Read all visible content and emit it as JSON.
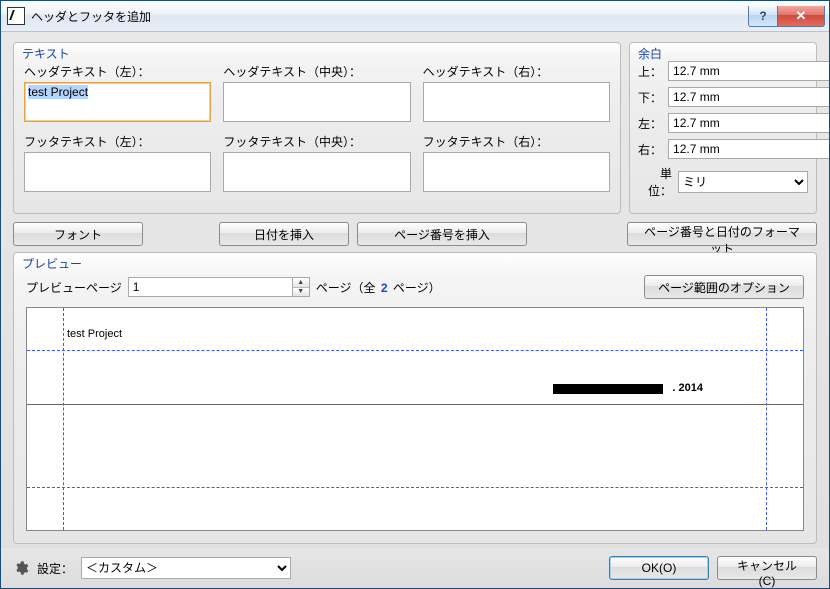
{
  "window": {
    "title": "ヘッダとフッタを追加"
  },
  "titlebar": {
    "help": "?",
    "close": "✕"
  },
  "text_group": {
    "legend": "テキスト",
    "fields": {
      "hl": {
        "label": "ヘッダテキスト（左）：",
        "value": "test Project"
      },
      "hc": {
        "label": "ヘッダテキスト（中央）：",
        "value": ""
      },
      "hr": {
        "label": "ヘッダテキスト（右）：",
        "value": ""
      },
      "fl": {
        "label": "フッタテキスト（左）：",
        "value": ""
      },
      "fc": {
        "label": "フッタテキスト（中央）：",
        "value": ""
      },
      "fr": {
        "label": "フッタテキスト（右）：",
        "value": ""
      }
    }
  },
  "margin_group": {
    "legend": "余白",
    "top": {
      "label": "上：",
      "value": "12.7 mm"
    },
    "bottom": {
      "label": "下：",
      "value": "12.7 mm"
    },
    "left": {
      "label": "左：",
      "value": "12.7 mm"
    },
    "right": {
      "label": "右：",
      "value": "12.7 mm"
    },
    "unit_label": "単位：",
    "unit_value": "ミリ"
  },
  "buttons": {
    "font": "フォント",
    "insert_date": "日付を挿入",
    "insert_page": "ページ番号を挿入",
    "format": "ページ番号と日付のフォーマット"
  },
  "preview": {
    "legend": "プレビュー",
    "page_label": "プレビューページ",
    "page_value": "1",
    "pages_prefix": "ページ（全 ",
    "pages_count": "2",
    "pages_suffix": " ページ）",
    "range_options": "ページ範囲のオプション",
    "sample_header_left": "test Project",
    "sample_year": ". 2014"
  },
  "footer": {
    "settings_label": "設定：",
    "settings_value": "＜カスタム＞",
    "ok": "OK(O)",
    "cancel": "キャンセル(C)"
  }
}
